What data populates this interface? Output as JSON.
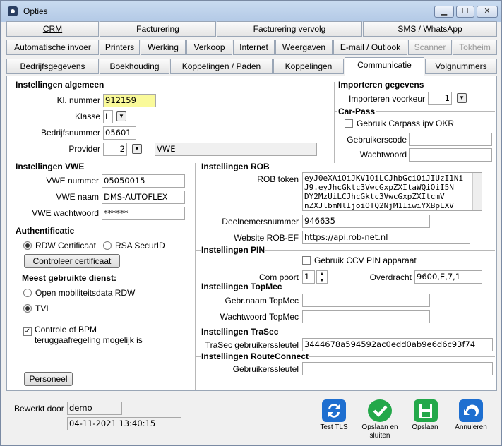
{
  "window": {
    "title": "Opties",
    "min": "▁",
    "max": "☐",
    "close": "✕"
  },
  "tabs_row1": [
    "CRM",
    "Facturering",
    "Facturering vervolg",
    "SMS / WhatsApp"
  ],
  "tabs_row2": [
    "Automatische invoer",
    "Printers",
    "Werking",
    "Verkoop",
    "Internet",
    "Weergaven",
    "E-mail / Outlook",
    "Scanner",
    "Tokheim"
  ],
  "tabs_row3": [
    "Bedrijfsgegevens",
    "Boekhouding",
    "Koppelingen / Paden",
    "Koppelingen",
    "Communicatie",
    "Volgnummers"
  ],
  "algemeen": {
    "title": "Instellingen algemeen",
    "kl_label": "Kl. nummer",
    "kl_value": "912159",
    "klasse_label": "Klasse",
    "klasse_value": "L",
    "bedrijf_label": "Bedrijfsnummer",
    "bedrijf_value": "05601",
    "provider_label": "Provider",
    "provider_value": "2",
    "provider_name": "VWE"
  },
  "importeren": {
    "title": "Importeren gegevens",
    "voorkeur_label": "Importeren voorkeur",
    "voorkeur_value": "1"
  },
  "carpass": {
    "title": "Car-Pass",
    "check_label": "Gebruik Carpass ipv OKR",
    "code_label": "Gebruikerscode",
    "code_value": "",
    "ww_label": "Wachtwoord",
    "ww_value": ""
  },
  "vwe": {
    "title": "Instellingen VWE",
    "nummer_label": "VWE nummer",
    "nummer_value": "05050015",
    "naam_label": "VWE naam",
    "naam_value": "DMS-AUTOFLEX",
    "ww_label": "VWE wachtwoord",
    "ww_value": "******"
  },
  "auth": {
    "title": "Authentificatie",
    "rdw_label": "RDW Certificaat",
    "rsa_label": "RSA SecurID",
    "check_btn": "Controleer certificaat",
    "dienst_title": "Meest gebruikte dienst:",
    "opt1": "Open mobiliteitsdata RDW",
    "opt2": "TVI",
    "bpm_line1": "Controle of BPM",
    "bpm_line2": "teruggaafregeling mogelijk is",
    "personeel_btn": "Personeel"
  },
  "rob": {
    "title": "Instellingen ROB",
    "token_label": "ROB token",
    "token_value": "eyJ0eXAiOiJKV1QiLCJhbGciOiJIUzI1Ni\nJ9.eyJhcGktc3VwcGxpZXItaWQiOiI5N\nDY2MzUiLCJhcGktc3VwcGxpZXItcmV\nnZXJlbmNlIjoiOTQ2NjM1IiwiYXBpLXV",
    "deel_label": "Deelnemersnummer",
    "deel_value": "946635",
    "site_label": "Website ROB-EF",
    "site_value": "https://api.rob-net.nl"
  },
  "pin": {
    "title": "Instellingen PIN",
    "check_label": "Gebruik CCV PIN apparaat",
    "com_label": "Com poort",
    "com_value": "1",
    "over_label": "Overdracht",
    "over_value": "9600,E,7,1"
  },
  "topmec": {
    "title": "Instellingen TopMec",
    "naam_label": "Gebr.naam TopMec",
    "naam_value": "",
    "ww_label": "Wachtwoord TopMec",
    "ww_value": ""
  },
  "trasec": {
    "title": "Instellingen TraSec",
    "key_label": "TraSec gebruikerssleutel",
    "key_value": "3444678a594592ac0edd0ab9e6d6c93f74"
  },
  "routeconnect": {
    "title": "Instellingen RouteConnect",
    "key_label": "Gebruikerssleutel",
    "key_value": ""
  },
  "footer": {
    "bewerkt_label": "Bewerkt door",
    "bewerkt_value": "demo",
    "datum_value": "04-11-2021 13:40:15",
    "test_label": "Test TLS",
    "opslaan_sluiten_l1": "Opslaan en",
    "opslaan_sluiten_l2": "sluiten",
    "opslaan_label": "Opslaan",
    "annuleren_label": "Annuleren"
  },
  "colors": {
    "highlight": "#fafa9a",
    "accent_blue": "#1e6fd0",
    "accent_green": "#23a84a"
  }
}
